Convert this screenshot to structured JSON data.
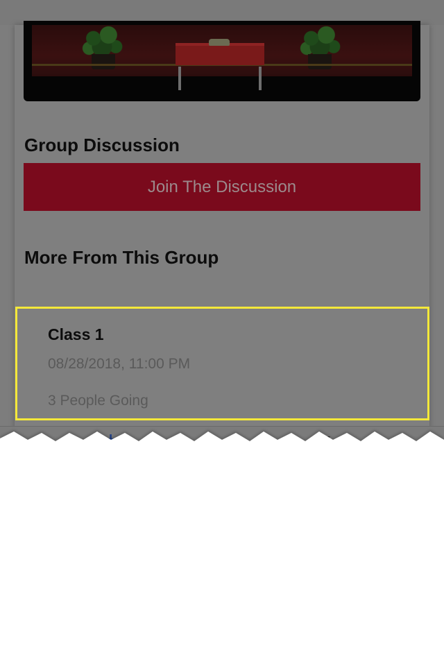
{
  "group_discussion": {
    "title": "Group Discussion",
    "join_label": "Join The Discussion"
  },
  "more_from_group": {
    "title": "More From This Group"
  },
  "event": {
    "title": "Class 1",
    "datetime": "08/28/2018, 11:00 PM",
    "attendance": "3 People Going"
  },
  "colors": {
    "dim_overlay": "#7d7d7d",
    "join_button": "#7a0a1c",
    "highlight_border": "#f4e83a",
    "tab_icon": "#1f3f86"
  },
  "icons": {
    "tab_left": "add-people-icon",
    "tab_right": "dropdown-caret-icon"
  }
}
